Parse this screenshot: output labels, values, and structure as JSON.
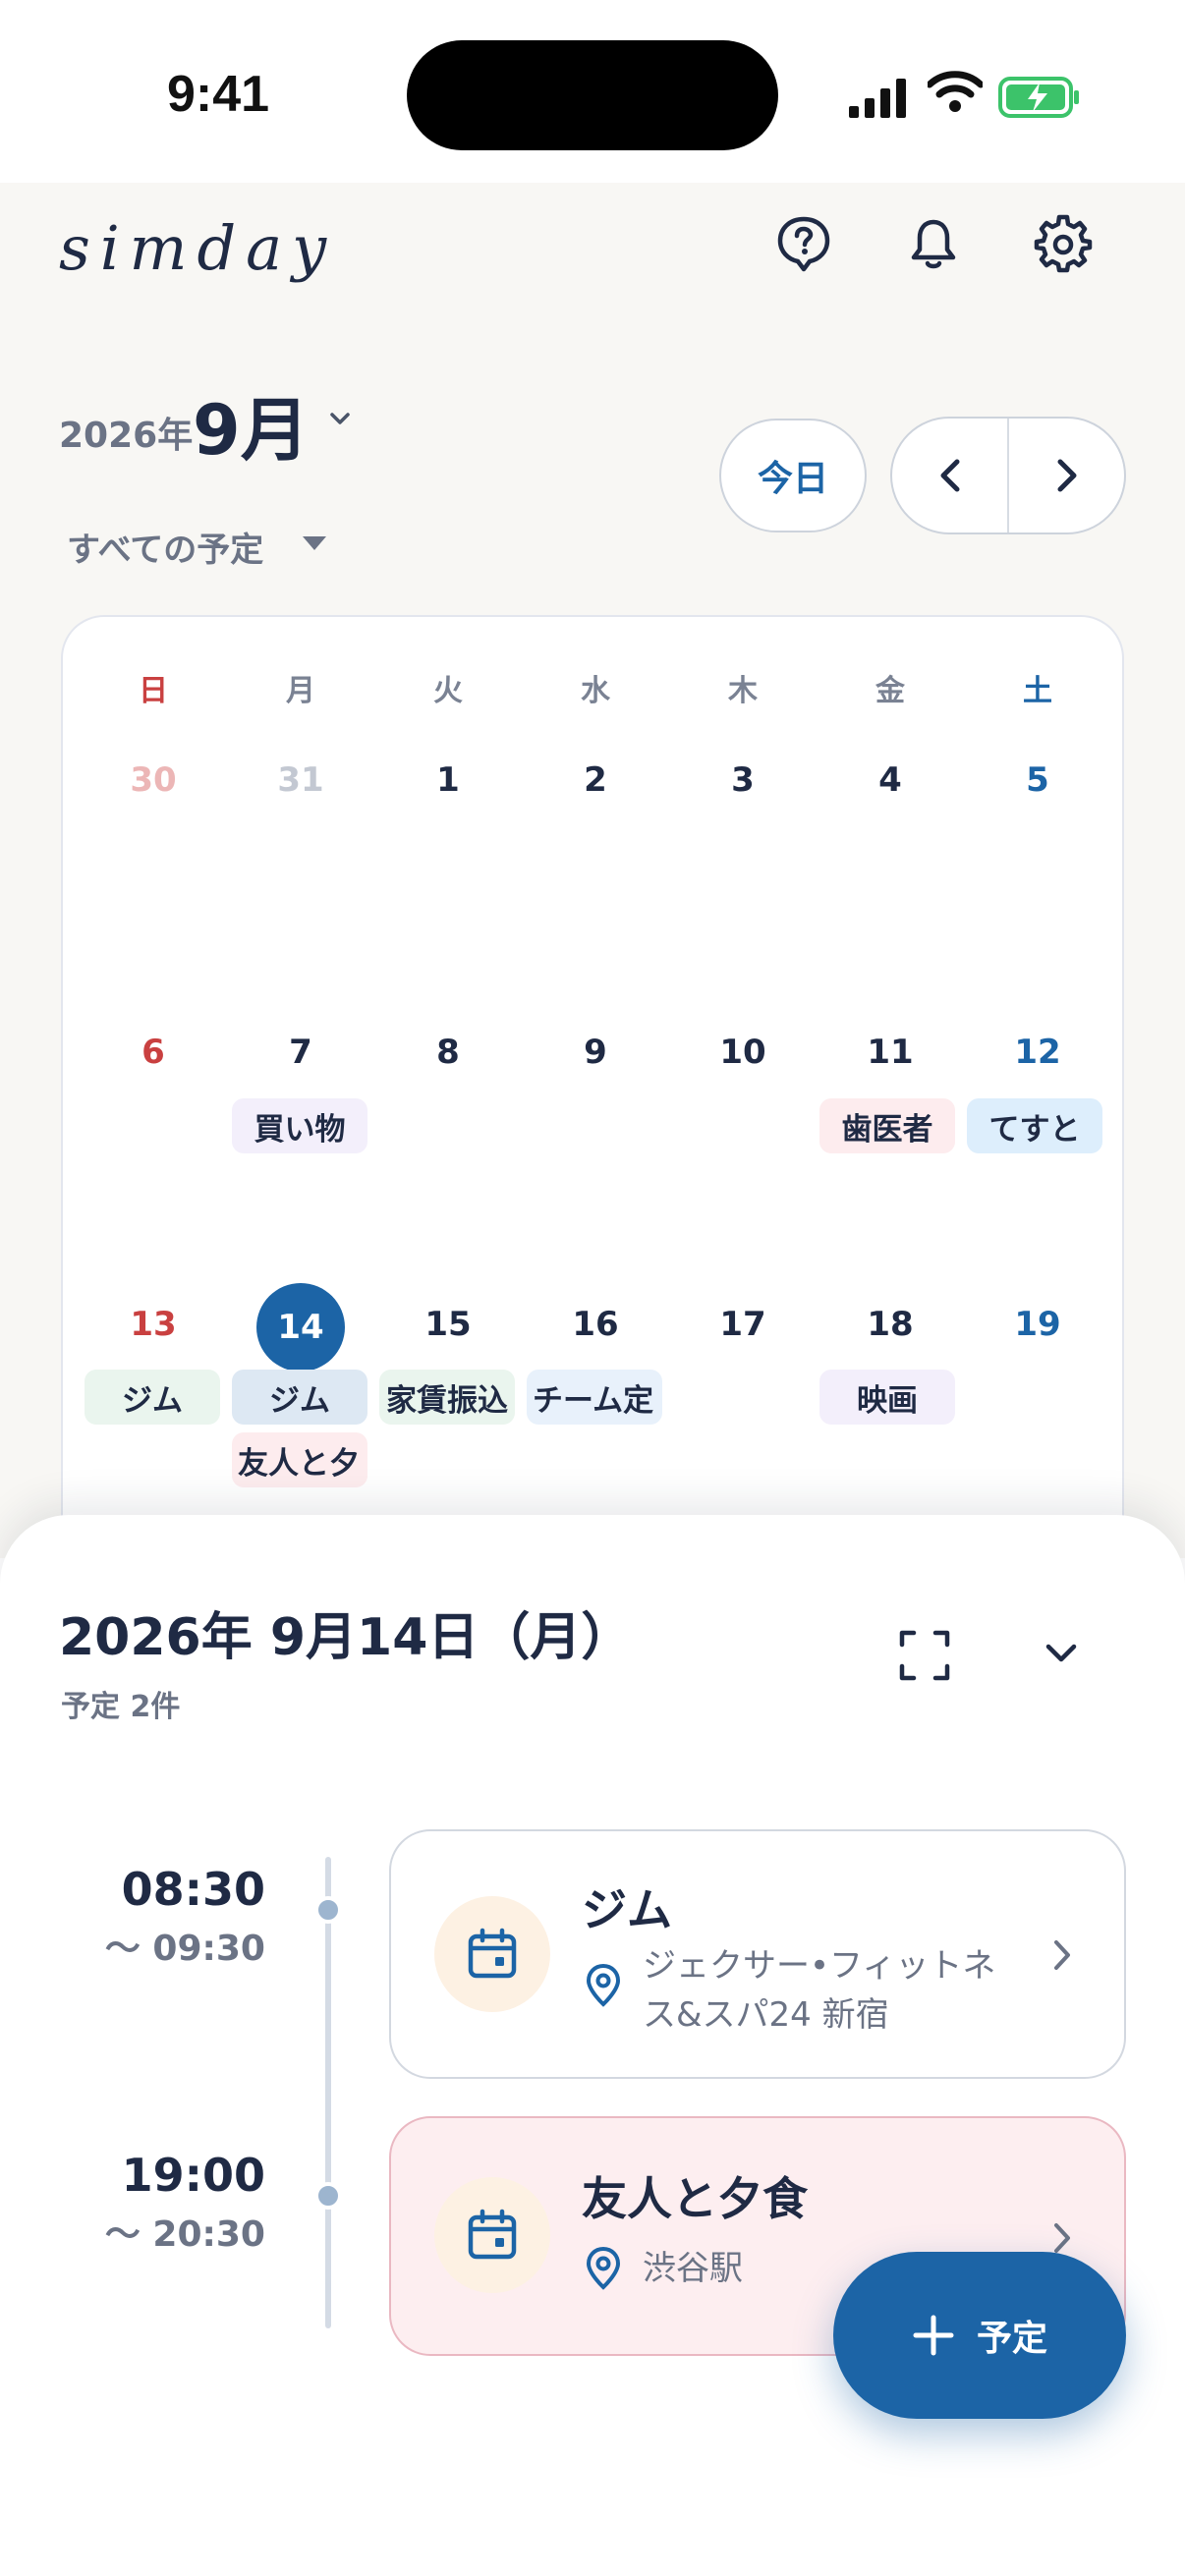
{
  "status": {
    "time": "9:41"
  },
  "app": {
    "logo": "simday"
  },
  "header": {
    "year": "2026年",
    "month": "9月",
    "filter": "すべての予定",
    "today_label": "今日"
  },
  "calendar": {
    "weekdays": [
      "日",
      "月",
      "火",
      "水",
      "木",
      "金",
      "土"
    ],
    "weeks": [
      [
        "30",
        "31",
        "1",
        "2",
        "3",
        "4",
        "5"
      ],
      [
        "6",
        "7",
        "8",
        "9",
        "10",
        "11",
        "12"
      ],
      [
        "13",
        "14",
        "15",
        "16",
        "17",
        "18",
        "19"
      ]
    ],
    "selected_day": "14",
    "chips": {
      "w1_mon": "買い物",
      "w1_fri": "歯医者",
      "w1_sat": "てすと",
      "w2_sun": "ジム",
      "w2_mon": "ジム",
      "w2_mon2": "友人と夕",
      "w2_tue": "家賃振込",
      "w2_wed": "チーム定",
      "w2_fri": "映画"
    }
  },
  "sheet": {
    "date_title": "2026年 9月14日（月）",
    "count": "予定 2件",
    "events": [
      {
        "start": "08:30",
        "end": "〜 09:30",
        "title": "ジム",
        "location": "ジェクサー•フィットネス&スパ24 新宿"
      },
      {
        "start": "19:00",
        "end": "〜 20:30",
        "title": "友人と夕食",
        "location": "渋谷駅"
      }
    ]
  },
  "fab": {
    "label": "予定"
  },
  "colors": {
    "accent": "#1c64a6",
    "sunday": "#c94040",
    "saturday": "#1c64a6",
    "background": "#f8f7f4"
  }
}
